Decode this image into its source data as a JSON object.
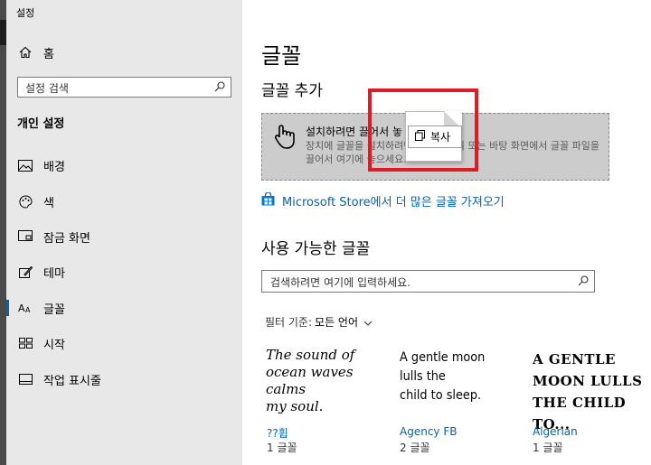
{
  "window": {
    "title": "설정"
  },
  "sidebar": {
    "home": "홈",
    "search_placeholder": "설정 검색",
    "section": "개인 설정",
    "items": [
      {
        "label": "배경",
        "icon": "picture-icon"
      },
      {
        "label": "색",
        "icon": "palette-icon"
      },
      {
        "label": "잠금 화면",
        "icon": "lock-screen-icon"
      },
      {
        "label": "테마",
        "icon": "brush-icon"
      },
      {
        "label": "글꼴",
        "icon": "font-icon"
      },
      {
        "label": "시작",
        "icon": "start-grid-icon"
      },
      {
        "label": "작업 표시줄",
        "icon": "taskbar-icon"
      }
    ]
  },
  "main": {
    "title": "글꼴",
    "add_heading": "글꼴 추가",
    "dropzone_title": "설치하려면 끌어서 놓",
    "dropzone_desc": "장치에 글꼴을 설치하려면 파일 탐색기 또는 바탕 화면에서 글꼴 파일을 끌어서 여기에 놓으세요.",
    "drag_copy_label": "복사",
    "store_link": "Microsoft Store에서 더 많은 글꼴 가져오기",
    "available_heading": "사용 가능한 글꼴",
    "font_search_placeholder": "검색하려면 여기에 입력하세요.",
    "filter_label": "필터 기준:",
    "filter_value": "모든 언어",
    "fonts": [
      {
        "sample_lines": [
          "The sound of",
          "ocean waves calms",
          "my soul."
        ],
        "name": "??휩",
        "count": "1 글꼴"
      },
      {
        "sample_lines": [
          "A gentle moon lulls the",
          "child to sleep."
        ],
        "name": "Agency FB",
        "count": "2 글꼴"
      },
      {
        "sample_lines": [
          "A GENTLE",
          "MOON LULLS",
          "THE CHILD TO..."
        ],
        "name": "Algerian",
        "count": "1 글꼴"
      }
    ]
  },
  "colors": {
    "accent": "#0063b1",
    "highlight_box": "#e01b24",
    "sidebar_bg": "#e8e8e8",
    "dropzone_bg": "#cccccc"
  }
}
